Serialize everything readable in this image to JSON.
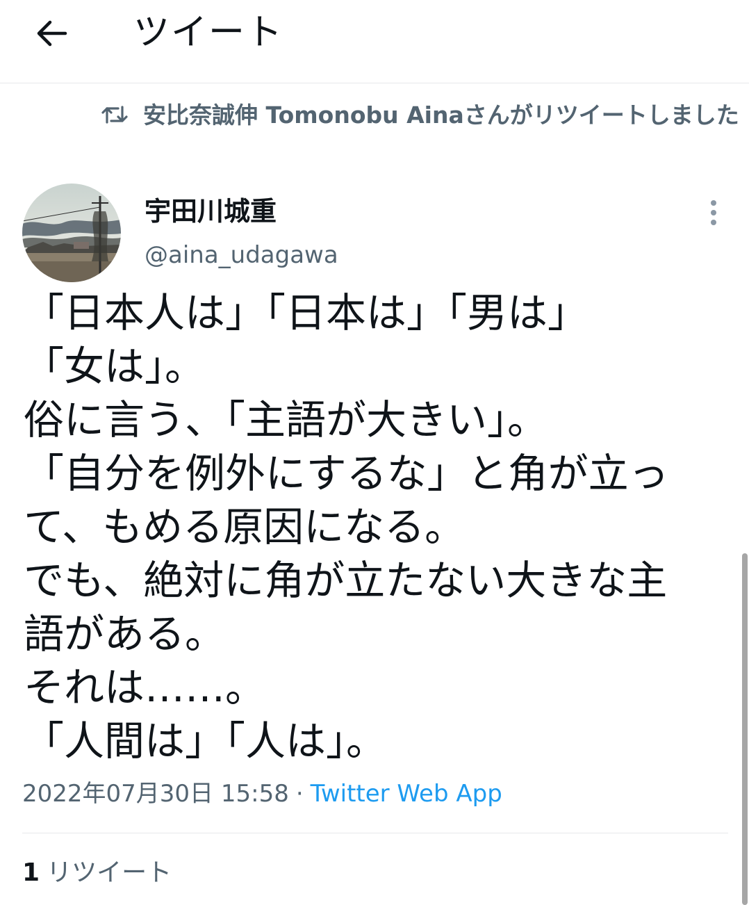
{
  "header": {
    "title": "ツイート",
    "back_icon": "arrow-left-icon"
  },
  "retweet_context": {
    "icon": "retweet-icon",
    "text": "安比奈誠伸 Tomonobu Ainaさんがリツイートしました"
  },
  "tweet": {
    "author": {
      "display_name": "宇田川城重",
      "handle": "@aina_udagawa"
    },
    "more_icon": "more-vertical-icon",
    "lines": [
      "「日本人は」「日本は」「男は」",
      "「女は」。",
      "俗に言う、「主語が大きい」。",
      "「自分を例外にするな」と角が立っ",
      "て、もめる原因になる。",
      "でも、絶対に角が立たない大きな主",
      "語がある。",
      "それは……。",
      "「人間は」「人は」。"
    ],
    "timestamp": "2022年07月30日 15:58",
    "separator": "·",
    "source": "Twitter Web App"
  },
  "stats": {
    "retweet_count": "1",
    "retweet_label": "リツイート"
  },
  "colors": {
    "primary_text": "#0f1419",
    "secondary_text": "#536471",
    "link": "#1d9bf0",
    "divider": "#e6e8eb"
  }
}
